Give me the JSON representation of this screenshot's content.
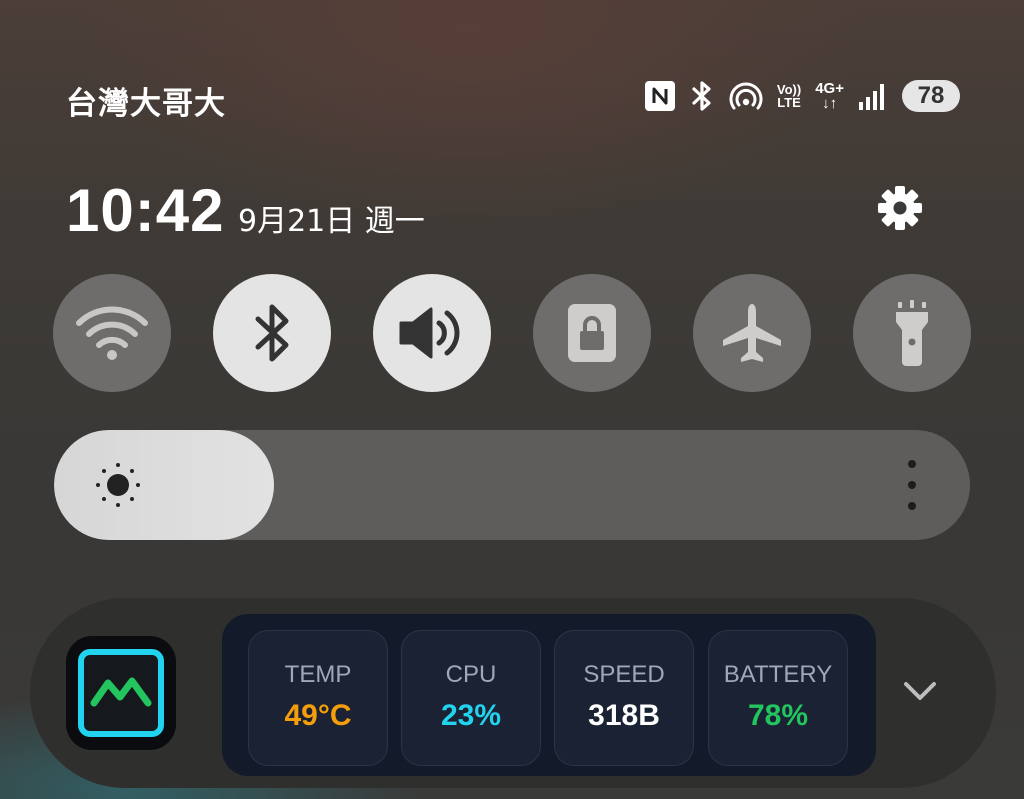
{
  "status_bar": {
    "carrier": "台灣大哥大",
    "volte_top": "Vo))",
    "volte_bottom": "LTE",
    "network_top": "4G+",
    "network_bottom": "↓↑",
    "battery": "78",
    "icons": [
      "nfc-icon",
      "bluetooth-icon",
      "hotspot-icon",
      "volte-icon",
      "4g-plus-icon",
      "signal-icon",
      "battery-icon"
    ]
  },
  "header": {
    "time": "10:42",
    "date": "9月21日 週一",
    "settings_icon": "gear-icon"
  },
  "quick_toggles": [
    {
      "name": "wifi",
      "icon": "wifi-icon",
      "state": "off"
    },
    {
      "name": "bluetooth",
      "icon": "bluetooth-icon",
      "state": "on"
    },
    {
      "name": "sound",
      "icon": "speaker-icon",
      "state": "on"
    },
    {
      "name": "screen-lock",
      "icon": "lock-icon",
      "state": "off"
    },
    {
      "name": "airplane-mode",
      "icon": "airplane-icon",
      "state": "off"
    },
    {
      "name": "flashlight",
      "icon": "flashlight-icon",
      "state": "off"
    }
  ],
  "brightness": {
    "level_percent": 24,
    "icon": "sun-icon",
    "more_icon": "more-vertical-icon"
  },
  "widget": {
    "app_icon": "monitor-app-icon",
    "stats": [
      {
        "label": "TEMP",
        "value": "49°C",
        "color": "#f59e0b"
      },
      {
        "label": "CPU",
        "value": "23%",
        "color": "#22d3ee"
      },
      {
        "label": "SPEED",
        "value": "318B",
        "color": "#ffffff"
      },
      {
        "label": "BATTERY",
        "value": "78%",
        "color": "#22c55e"
      }
    ],
    "expand_icon": "chevron-down-icon"
  }
}
